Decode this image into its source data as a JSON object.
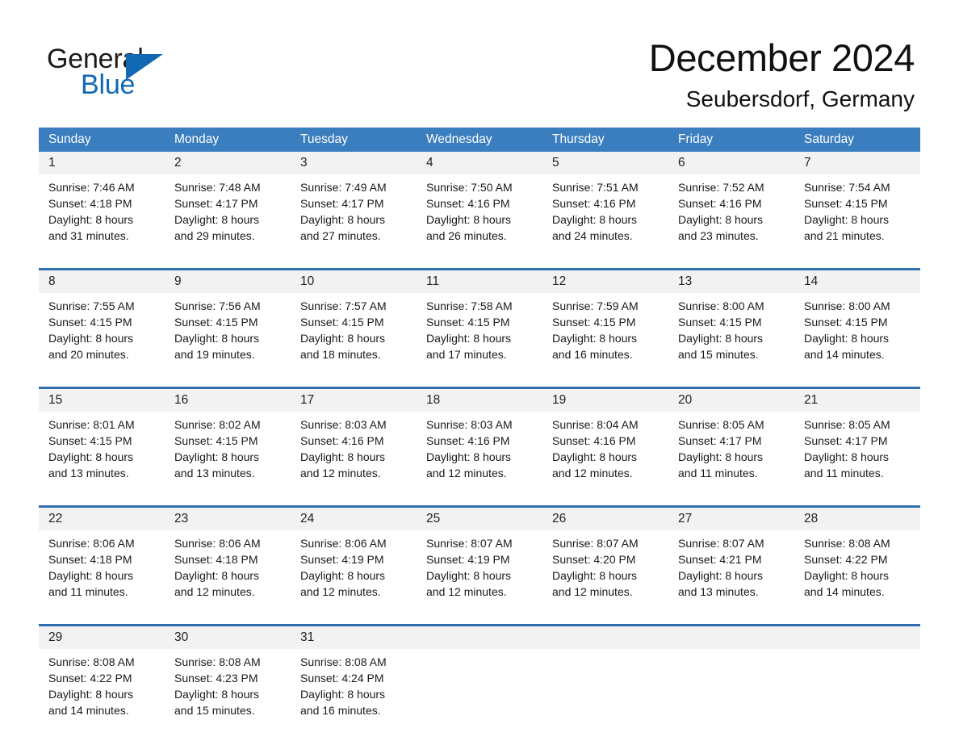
{
  "brand": {
    "name_part1": "General",
    "name_part2": "Blue",
    "triangle_icon": "triangle-icon",
    "accent_color": "#1268b3"
  },
  "header": {
    "month_title": "December 2024",
    "location": "Seubersdorf, Germany"
  },
  "theme": {
    "header_blue": "#3a7ebf",
    "row_divider_blue": "#2f6fad",
    "daynum_band_gray": "#f2f2f2",
    "text_dark": "#1a1a1a"
  },
  "calendar": {
    "weekdays": [
      "Sunday",
      "Monday",
      "Tuesday",
      "Wednesday",
      "Thursday",
      "Friday",
      "Saturday"
    ],
    "weeks": [
      [
        {
          "day": "1",
          "sunrise": "Sunrise: 7:46 AM",
          "sunset": "Sunset: 4:18 PM",
          "daylight_line1": "Daylight: 8 hours",
          "daylight_line2": "and 31 minutes."
        },
        {
          "day": "2",
          "sunrise": "Sunrise: 7:48 AM",
          "sunset": "Sunset: 4:17 PM",
          "daylight_line1": "Daylight: 8 hours",
          "daylight_line2": "and 29 minutes."
        },
        {
          "day": "3",
          "sunrise": "Sunrise: 7:49 AM",
          "sunset": "Sunset: 4:17 PM",
          "daylight_line1": "Daylight: 8 hours",
          "daylight_line2": "and 27 minutes."
        },
        {
          "day": "4",
          "sunrise": "Sunrise: 7:50 AM",
          "sunset": "Sunset: 4:16 PM",
          "daylight_line1": "Daylight: 8 hours",
          "daylight_line2": "and 26 minutes."
        },
        {
          "day": "5",
          "sunrise": "Sunrise: 7:51 AM",
          "sunset": "Sunset: 4:16 PM",
          "daylight_line1": "Daylight: 8 hours",
          "daylight_line2": "and 24 minutes."
        },
        {
          "day": "6",
          "sunrise": "Sunrise: 7:52 AM",
          "sunset": "Sunset: 4:16 PM",
          "daylight_line1": "Daylight: 8 hours",
          "daylight_line2": "and 23 minutes."
        },
        {
          "day": "7",
          "sunrise": "Sunrise: 7:54 AM",
          "sunset": "Sunset: 4:15 PM",
          "daylight_line1": "Daylight: 8 hours",
          "daylight_line2": "and 21 minutes."
        }
      ],
      [
        {
          "day": "8",
          "sunrise": "Sunrise: 7:55 AM",
          "sunset": "Sunset: 4:15 PM",
          "daylight_line1": "Daylight: 8 hours",
          "daylight_line2": "and 20 minutes."
        },
        {
          "day": "9",
          "sunrise": "Sunrise: 7:56 AM",
          "sunset": "Sunset: 4:15 PM",
          "daylight_line1": "Daylight: 8 hours",
          "daylight_line2": "and 19 minutes."
        },
        {
          "day": "10",
          "sunrise": "Sunrise: 7:57 AM",
          "sunset": "Sunset: 4:15 PM",
          "daylight_line1": "Daylight: 8 hours",
          "daylight_line2": "and 18 minutes."
        },
        {
          "day": "11",
          "sunrise": "Sunrise: 7:58 AM",
          "sunset": "Sunset: 4:15 PM",
          "daylight_line1": "Daylight: 8 hours",
          "daylight_line2": "and 17 minutes."
        },
        {
          "day": "12",
          "sunrise": "Sunrise: 7:59 AM",
          "sunset": "Sunset: 4:15 PM",
          "daylight_line1": "Daylight: 8 hours",
          "daylight_line2": "and 16 minutes."
        },
        {
          "day": "13",
          "sunrise": "Sunrise: 8:00 AM",
          "sunset": "Sunset: 4:15 PM",
          "daylight_line1": "Daylight: 8 hours",
          "daylight_line2": "and 15 minutes."
        },
        {
          "day": "14",
          "sunrise": "Sunrise: 8:00 AM",
          "sunset": "Sunset: 4:15 PM",
          "daylight_line1": "Daylight: 8 hours",
          "daylight_line2": "and 14 minutes."
        }
      ],
      [
        {
          "day": "15",
          "sunrise": "Sunrise: 8:01 AM",
          "sunset": "Sunset: 4:15 PM",
          "daylight_line1": "Daylight: 8 hours",
          "daylight_line2": "and 13 minutes."
        },
        {
          "day": "16",
          "sunrise": "Sunrise: 8:02 AM",
          "sunset": "Sunset: 4:15 PM",
          "daylight_line1": "Daylight: 8 hours",
          "daylight_line2": "and 13 minutes."
        },
        {
          "day": "17",
          "sunrise": "Sunrise: 8:03 AM",
          "sunset": "Sunset: 4:16 PM",
          "daylight_line1": "Daylight: 8 hours",
          "daylight_line2": "and 12 minutes."
        },
        {
          "day": "18",
          "sunrise": "Sunrise: 8:03 AM",
          "sunset": "Sunset: 4:16 PM",
          "daylight_line1": "Daylight: 8 hours",
          "daylight_line2": "and 12 minutes."
        },
        {
          "day": "19",
          "sunrise": "Sunrise: 8:04 AM",
          "sunset": "Sunset: 4:16 PM",
          "daylight_line1": "Daylight: 8 hours",
          "daylight_line2": "and 12 minutes."
        },
        {
          "day": "20",
          "sunrise": "Sunrise: 8:05 AM",
          "sunset": "Sunset: 4:17 PM",
          "daylight_line1": "Daylight: 8 hours",
          "daylight_line2": "and 11 minutes."
        },
        {
          "day": "21",
          "sunrise": "Sunrise: 8:05 AM",
          "sunset": "Sunset: 4:17 PM",
          "daylight_line1": "Daylight: 8 hours",
          "daylight_line2": "and 11 minutes."
        }
      ],
      [
        {
          "day": "22",
          "sunrise": "Sunrise: 8:06 AM",
          "sunset": "Sunset: 4:18 PM",
          "daylight_line1": "Daylight: 8 hours",
          "daylight_line2": "and 11 minutes."
        },
        {
          "day": "23",
          "sunrise": "Sunrise: 8:06 AM",
          "sunset": "Sunset: 4:18 PM",
          "daylight_line1": "Daylight: 8 hours",
          "daylight_line2": "and 12 minutes."
        },
        {
          "day": "24",
          "sunrise": "Sunrise: 8:06 AM",
          "sunset": "Sunset: 4:19 PM",
          "daylight_line1": "Daylight: 8 hours",
          "daylight_line2": "and 12 minutes."
        },
        {
          "day": "25",
          "sunrise": "Sunrise: 8:07 AM",
          "sunset": "Sunset: 4:19 PM",
          "daylight_line1": "Daylight: 8 hours",
          "daylight_line2": "and 12 minutes."
        },
        {
          "day": "26",
          "sunrise": "Sunrise: 8:07 AM",
          "sunset": "Sunset: 4:20 PM",
          "daylight_line1": "Daylight: 8 hours",
          "daylight_line2": "and 12 minutes."
        },
        {
          "day": "27",
          "sunrise": "Sunrise: 8:07 AM",
          "sunset": "Sunset: 4:21 PM",
          "daylight_line1": "Daylight: 8 hours",
          "daylight_line2": "and 13 minutes."
        },
        {
          "day": "28",
          "sunrise": "Sunrise: 8:08 AM",
          "sunset": "Sunset: 4:22 PM",
          "daylight_line1": "Daylight: 8 hours",
          "daylight_line2": "and 14 minutes."
        }
      ],
      [
        {
          "day": "29",
          "sunrise": "Sunrise: 8:08 AM",
          "sunset": "Sunset: 4:22 PM",
          "daylight_line1": "Daylight: 8 hours",
          "daylight_line2": "and 14 minutes."
        },
        {
          "day": "30",
          "sunrise": "Sunrise: 8:08 AM",
          "sunset": "Sunset: 4:23 PM",
          "daylight_line1": "Daylight: 8 hours",
          "daylight_line2": "and 15 minutes."
        },
        {
          "day": "31",
          "sunrise": "Sunrise: 8:08 AM",
          "sunset": "Sunset: 4:24 PM",
          "daylight_line1": "Daylight: 8 hours",
          "daylight_line2": "and 16 minutes."
        },
        {
          "day": "",
          "sunrise": "",
          "sunset": "",
          "daylight_line1": "",
          "daylight_line2": ""
        },
        {
          "day": "",
          "sunrise": "",
          "sunset": "",
          "daylight_line1": "",
          "daylight_line2": ""
        },
        {
          "day": "",
          "sunrise": "",
          "sunset": "",
          "daylight_line1": "",
          "daylight_line2": ""
        },
        {
          "day": "",
          "sunrise": "",
          "sunset": "",
          "daylight_line1": "",
          "daylight_line2": ""
        }
      ]
    ]
  }
}
